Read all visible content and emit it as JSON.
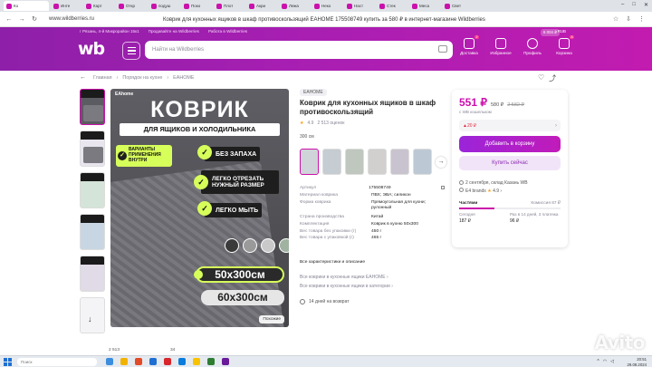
{
  "browser": {
    "tabs": [
      "Ко",
      "Инте",
      "Карт",
      "Откр",
      "подуш",
      "Поко",
      "Плот",
      "Акри",
      "Лежа",
      "Неко",
      "Наст",
      "Стек",
      "Меса",
      "Свет"
    ],
    "url": "www.wildberries.ru",
    "page_title": "Коврик для кухонных ящиков в шкаф противоскользящий EAHOME 175508749 купить за 580 ₽ в интернет-магазине Wildberries",
    "window_controls": [
      "–",
      "□",
      "✕"
    ]
  },
  "header": {
    "location": "г Рязань, 4-й Микрорайон 15к1",
    "sell_link": "Продавайте на Wildberries",
    "work_link": "Работа в Wildberries",
    "logo": "wb",
    "search_placeholder": "Найти на Wildberries",
    "balance": "6 004 ₽",
    "currency": "RUB",
    "icons": [
      {
        "label": "Доставка",
        "count": "2",
        "icon": "delivery-icon"
      },
      {
        "label": "Избранное",
        "count": "",
        "icon": "heart-icon"
      },
      {
        "label": "Профиль",
        "count": "",
        "icon": "user-icon"
      },
      {
        "label": "Корзина",
        "count": "8",
        "icon": "cart-icon"
      }
    ]
  },
  "breadcrumb": [
    "Главная",
    "Порядок на кухне",
    "EAHOME"
  ],
  "product": {
    "brand": "EAHOME",
    "title": "Коврик для кухонных ящиков в шкаф противоскользящий",
    "rating": "4.9",
    "reviews": "2 513 оценок",
    "volume": "300 см",
    "image": {
      "brand_mini": "EAhome",
      "title": "КОВРИК",
      "subtitle": "ДЛЯ ЯЩИКОВ И ХОЛОДИЛЬНИКА",
      "variants": "ВАРИАНТЫ ПРИМЕНЕНИЯ ВНУТРИ",
      "features": [
        "БЕЗ ЗАПАХА",
        "ЛЕГКО ОТРЕЗАТЬ НУЖНЫЙ РАЗМЕР",
        "ЛЕГКО МЫТЬ"
      ],
      "size_primary": "50x300см",
      "size_secondary": "60x300см",
      "similar_button": "Похожие",
      "swatch_colors": [
        "#3a3a3a",
        "#9a9a9a",
        "#c9c9c9",
        "#9fb3a0",
        "#a9b9d4"
      ]
    },
    "specs": [
      {
        "k": "Артикул",
        "v": "175508749"
      },
      {
        "k": "Материал коврика",
        "v": "ПВХ; ЭВА; силикон"
      },
      {
        "k": "Форма коврика",
        "v": "Прямоугольная для кухни; рулонный"
      },
      {
        "k": "Страна производства",
        "v": "Китай"
      },
      {
        "k": "Комплектация",
        "v": "Коврик в кухню 50х300"
      },
      {
        "k": "Вес товара без упаковки (г)",
        "v": "450 г"
      },
      {
        "k": "Вес товара с упаковкой (г)",
        "v": "465 г"
      }
    ],
    "all_specs_link": "Все характеристики и описание",
    "links": [
      "Все коврики в кухонные ящики EAHOME",
      "Все коврики в кухонные ящики в категории"
    ],
    "return_text": "14 дней на возврат"
  },
  "price": {
    "main": "551 ₽",
    "alt": "580 ₽",
    "old": "2 582 ₽",
    "wallet": "с WB кошельком",
    "discount": "▲20 ₽",
    "add_to_cart": "Добавить в корзину",
    "buy_now": "Купить сейчас",
    "delivery": "2 сентября, склад Казань WB",
    "seller": "E4 brands",
    "seller_rating": "4.9",
    "installments_label": "Частями",
    "commission_label": "Комиссия 87 ₽",
    "installments_progress": 0.35,
    "today_label": "Сегодня",
    "today_value": "187 ₽",
    "biweekly_label": "Раз в 14 дней, 3 платежа",
    "biweekly_value": "96 ₽"
  },
  "watermark": "Avito",
  "bottom_counts": [
    "2 513",
    "34"
  ],
  "taskbar": {
    "search_placeholder": "Поиск",
    "time": "20:51",
    "date": "29.08.2024"
  },
  "colors": {
    "brand_purple": "#cb11ab",
    "header_gradient_start": "#8e1fa8",
    "accent_lime": "#d7ff5a"
  }
}
